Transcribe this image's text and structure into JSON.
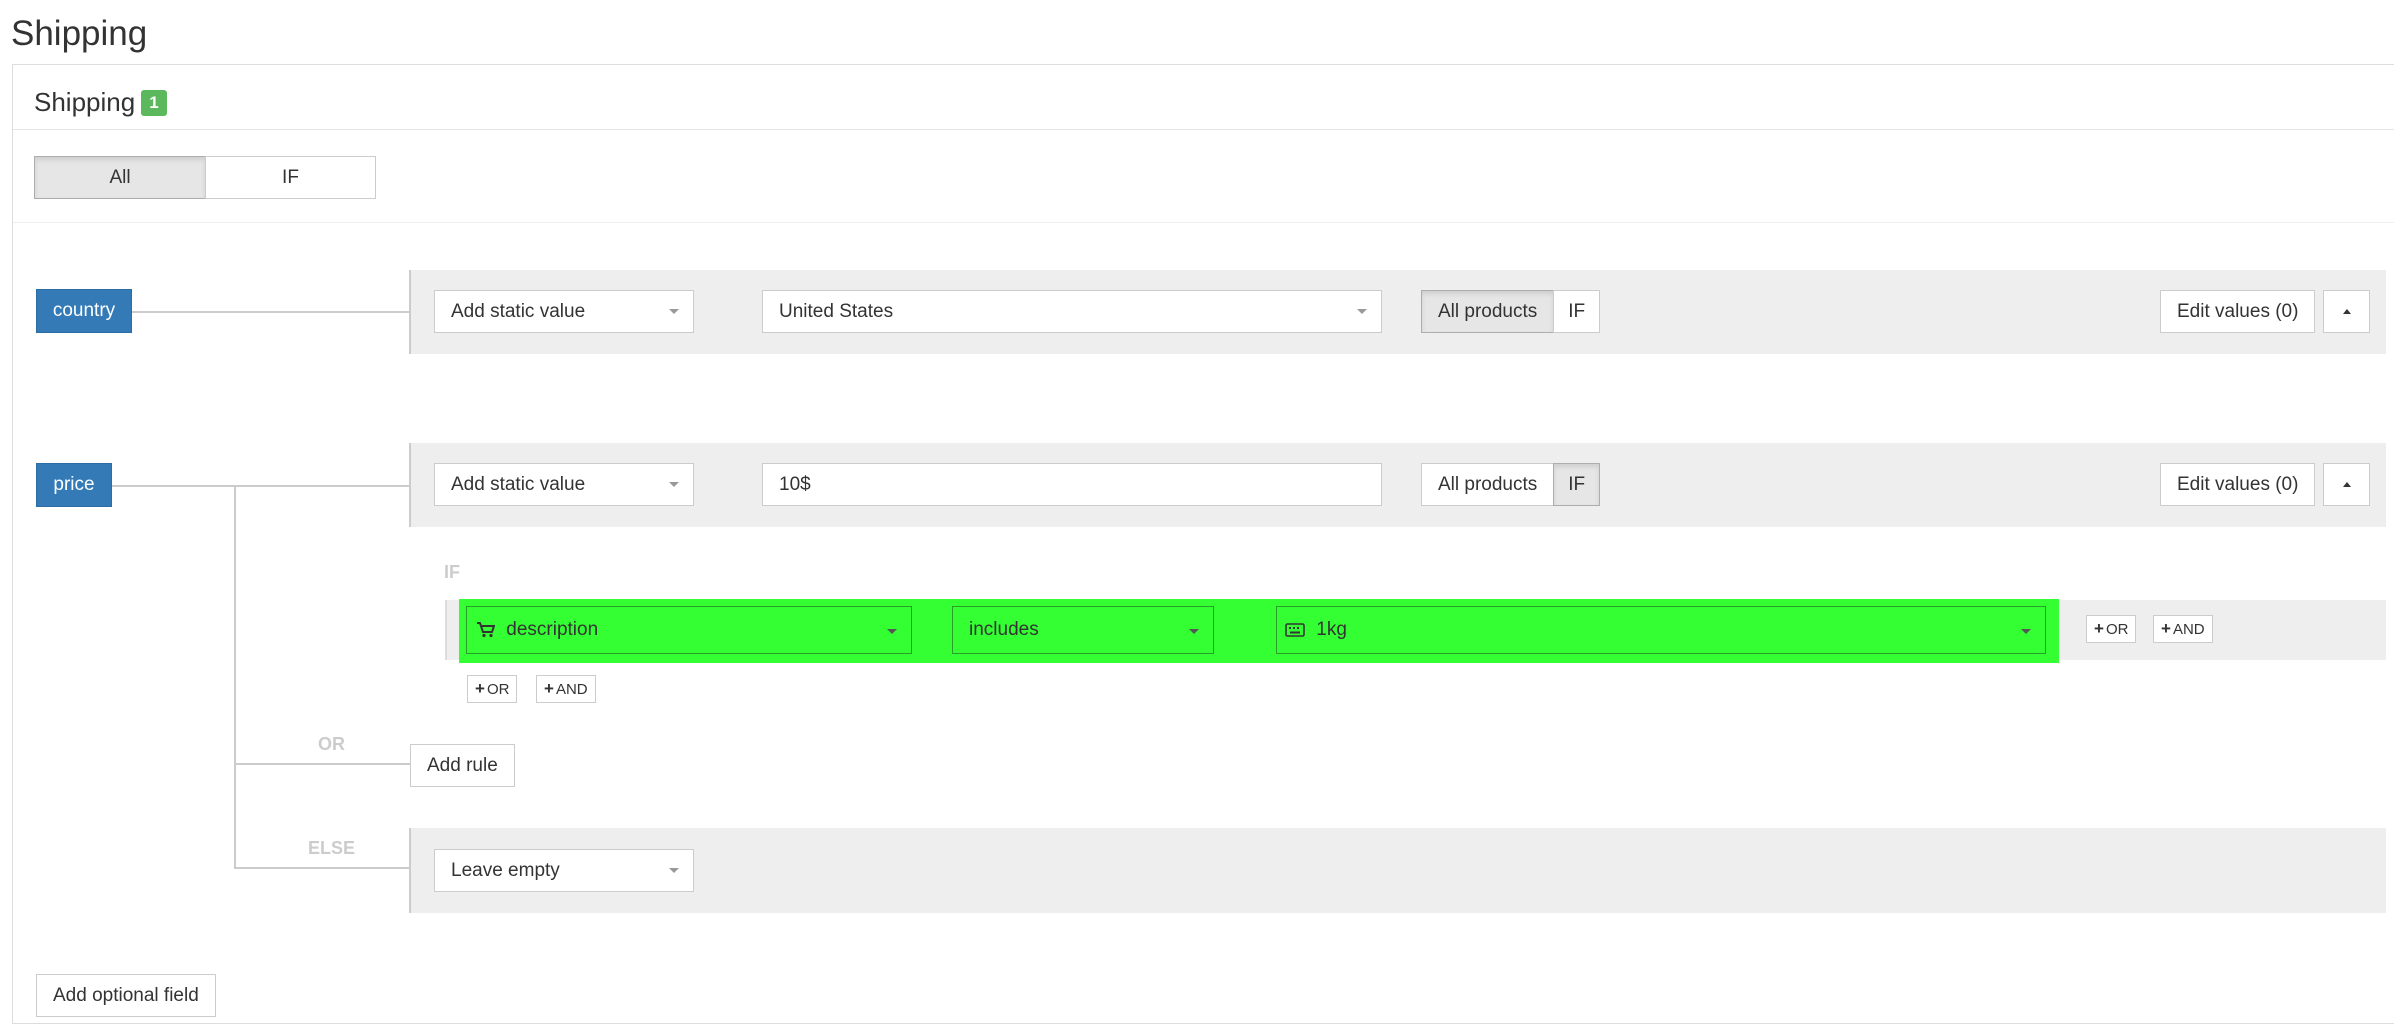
{
  "page": {
    "title": "Shipping"
  },
  "panel": {
    "title": "Shipping",
    "badge": "1"
  },
  "mode_toggle": {
    "all": "All",
    "if": "IF",
    "selected": "All"
  },
  "fields": [
    {
      "name": "country",
      "source_select": "Add static value",
      "value": "United States",
      "products_scope": {
        "all": "All products",
        "if": "IF",
        "selected": "All products"
      },
      "edit_values": "Edit values (0)"
    },
    {
      "name": "price",
      "source_select": "Add static value",
      "value": "10$",
      "products_scope": {
        "all": "All products",
        "if": "IF",
        "selected": "IF"
      },
      "edit_values": "Edit values (0)",
      "if_label": "IF",
      "condition": {
        "attribute": "description",
        "attribute_icon": "cart-icon",
        "operator": "includes",
        "value": "1kg",
        "value_icon": "keyboard-icon",
        "highlight_color": "#33ff33"
      },
      "row_or": "OR",
      "row_and": "AND",
      "group_or": "OR",
      "group_and": "AND",
      "or_label": "OR",
      "add_rule": "Add rule",
      "else_label": "ELSE",
      "else_select": "Leave empty"
    }
  ],
  "add_optional_field": "Add optional field",
  "colors": {
    "field_button": "#337ab7",
    "badge": "#5cb85c",
    "band": "#eeeeee"
  }
}
